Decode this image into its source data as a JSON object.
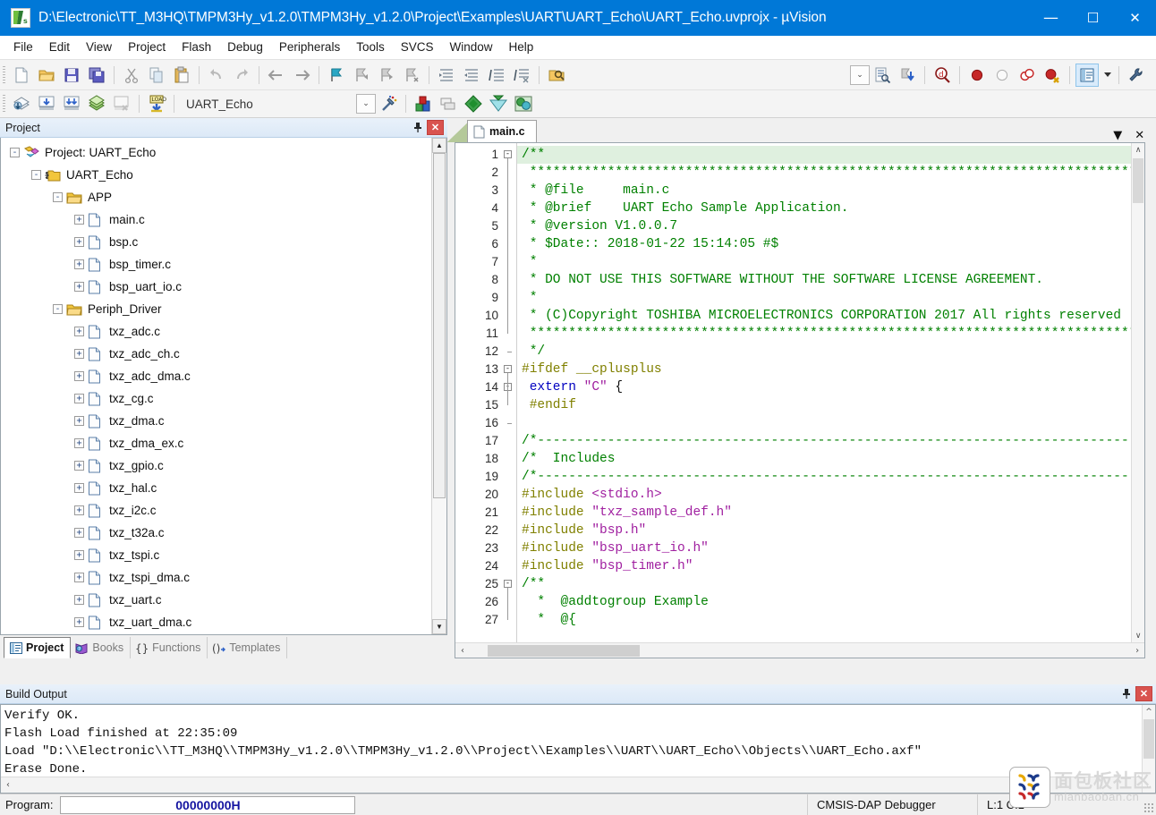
{
  "window": {
    "title": "D:\\Electronic\\TT_M3HQ\\TMPM3Hy_v1.2.0\\TMPM3Hy_v1.2.0\\Project\\Examples\\UART\\UART_Echo\\UART_Echo.uvprojx - µVision",
    "app_icon": "uvision-icon",
    "minimize": "—",
    "maximize": "☐",
    "close": "✕",
    "accent": "#0078d7"
  },
  "menu": {
    "items": [
      "File",
      "Edit",
      "View",
      "Project",
      "Flash",
      "Debug",
      "Peripherals",
      "Tools",
      "SVCS",
      "Window",
      "Help"
    ]
  },
  "toolbar_main": {
    "groups": [
      [
        "new-file-icon",
        "open-file-icon",
        "save-icon",
        "save-all-icon"
      ],
      [
        "cut-icon",
        "copy-icon",
        "paste-icon"
      ],
      [
        "undo-icon",
        "redo-icon"
      ],
      [
        "navigate-back-icon",
        "navigate-forward-icon"
      ],
      [
        "bookmark-toggle-icon",
        "bookmark-previous-icon",
        "bookmark-next-icon",
        "bookmark-clear-icon"
      ],
      [
        "indent-increase-icon",
        "indent-decrease-icon",
        "comment-lines-icon",
        "uncomment-lines-icon"
      ],
      [
        "open-in-explorer-icon"
      ]
    ],
    "right_groups": [
      [
        "search-dropdown-combo",
        "find-in-files-icon",
        "insert-bookmark-icon"
      ],
      [
        "find-icon"
      ],
      [
        "breakpoint-insert-icon",
        "breakpoint-disable-icon",
        "breakpoint-kill-all-icon",
        "breakpoint-disable-all-icon"
      ],
      [
        "project-window-icon",
        "project-window-dropdown-icon"
      ],
      [
        "configuration-wizard-icon"
      ]
    ]
  },
  "toolbar_build": {
    "icons": [
      "translate-file-icon",
      "build-target-icon",
      "rebuild-all-icon",
      "batch-build-icon",
      "stop-build-icon",
      "download-icon"
    ],
    "target_label": "UART_Echo",
    "combo_caret": "⌄",
    "right_icons": [
      "start-debug-session-icon",
      "target-options-icon",
      "manage-project-items-icon",
      "pack-installer-icon",
      "manage-runtime-env-icon",
      "select-software-packs-icon"
    ]
  },
  "project_panel": {
    "caption": "Project",
    "pin_icon": "pin-icon",
    "close_icon": "close-icon",
    "scrollbar": {
      "up": "▲",
      "down": "▼"
    },
    "tree": [
      {
        "label": "Project: UART_Echo",
        "depth": 0,
        "expander": "-",
        "icon": "project-icon"
      },
      {
        "label": "UART_Echo",
        "depth": 1,
        "expander": "-",
        "icon": "target-icon"
      },
      {
        "label": "APP",
        "depth": 2,
        "expander": "-",
        "icon": "folder-icon"
      },
      {
        "label": "main.c",
        "depth": 3,
        "expander": "+",
        "icon": "c-file-icon"
      },
      {
        "label": "bsp.c",
        "depth": 3,
        "expander": "+",
        "icon": "c-file-icon"
      },
      {
        "label": "bsp_timer.c",
        "depth": 3,
        "expander": "+",
        "icon": "c-file-icon"
      },
      {
        "label": "bsp_uart_io.c",
        "depth": 3,
        "expander": "+",
        "icon": "c-file-icon"
      },
      {
        "label": "Periph_Driver",
        "depth": 2,
        "expander": "-",
        "icon": "folder-icon"
      },
      {
        "label": "txz_adc.c",
        "depth": 3,
        "expander": "+",
        "icon": "c-file-icon"
      },
      {
        "label": "txz_adc_ch.c",
        "depth": 3,
        "expander": "+",
        "icon": "c-file-icon"
      },
      {
        "label": "txz_adc_dma.c",
        "depth": 3,
        "expander": "+",
        "icon": "c-file-icon"
      },
      {
        "label": "txz_cg.c",
        "depth": 3,
        "expander": "+",
        "icon": "c-file-icon"
      },
      {
        "label": "txz_dma.c",
        "depth": 3,
        "expander": "+",
        "icon": "c-file-icon"
      },
      {
        "label": "txz_dma_ex.c",
        "depth": 3,
        "expander": "+",
        "icon": "c-file-icon"
      },
      {
        "label": "txz_gpio.c",
        "depth": 3,
        "expander": "+",
        "icon": "c-file-icon"
      },
      {
        "label": "txz_hal.c",
        "depth": 3,
        "expander": "+",
        "icon": "c-file-icon"
      },
      {
        "label": "txz_i2c.c",
        "depth": 3,
        "expander": "+",
        "icon": "c-file-icon"
      },
      {
        "label": "txz_t32a.c",
        "depth": 3,
        "expander": "+",
        "icon": "c-file-icon"
      },
      {
        "label": "txz_tspi.c",
        "depth": 3,
        "expander": "+",
        "icon": "c-file-icon"
      },
      {
        "label": "txz_tspi_dma.c",
        "depth": 3,
        "expander": "+",
        "icon": "c-file-icon"
      },
      {
        "label": "txz_uart.c",
        "depth": 3,
        "expander": "+",
        "icon": "c-file-icon"
      },
      {
        "label": "txz_uart_dma.c",
        "depth": 3,
        "expander": "+",
        "icon": "c-file-icon"
      }
    ],
    "tabs": [
      {
        "label": "Project",
        "icon": "project-tab-icon",
        "selected": true
      },
      {
        "label": "Books",
        "icon": "books-tab-icon",
        "selected": false
      },
      {
        "label": "Functions",
        "icon": "functions-tab-icon",
        "selected": false
      },
      {
        "label": "Templates",
        "icon": "templates-tab-icon",
        "selected": false
      }
    ]
  },
  "editor": {
    "tab_label": "main.c",
    "tab_icon": "c-file-icon",
    "tab_list_caret": "▼",
    "tab_close": "✕",
    "scroll_up": "∧",
    "scroll_down": "∨",
    "hscroll_left": "‹",
    "hscroll_right": "›",
    "lines": [
      {
        "n": 1,
        "fold": "-",
        "highlight": true,
        "segments": [
          {
            "t": "/**",
            "c": "cm"
          }
        ]
      },
      {
        "n": 2,
        "fold": "",
        "highlight": false,
        "segments": [
          {
            "t": " *******************************************************************************",
            "c": "cm"
          }
        ]
      },
      {
        "n": 3,
        "fold": "",
        "highlight": false,
        "segments": [
          {
            "t": " * @file     main.c",
            "c": "cm"
          }
        ]
      },
      {
        "n": 4,
        "fold": "",
        "highlight": false,
        "segments": [
          {
            "t": " * @brief    UART Echo Sample Application.",
            "c": "cm"
          }
        ]
      },
      {
        "n": 5,
        "fold": "",
        "highlight": false,
        "segments": [
          {
            "t": " * @version V1.0.0.7",
            "c": "cm"
          }
        ]
      },
      {
        "n": 6,
        "fold": "",
        "highlight": false,
        "segments": [
          {
            "t": " * $Date:: 2018-01-22 15:14:05 #$",
            "c": "cm"
          }
        ]
      },
      {
        "n": 7,
        "fold": "",
        "highlight": false,
        "segments": [
          {
            "t": " *",
            "c": "cm"
          }
        ]
      },
      {
        "n": 8,
        "fold": "",
        "highlight": false,
        "segments": [
          {
            "t": " * DO NOT USE THIS SOFTWARE WITHOUT THE SOFTWARE LICENSE AGREEMENT.",
            "c": "cm"
          }
        ]
      },
      {
        "n": 9,
        "fold": "",
        "highlight": false,
        "segments": [
          {
            "t": " *",
            "c": "cm"
          }
        ]
      },
      {
        "n": 10,
        "fold": "",
        "highlight": false,
        "segments": [
          {
            "t": " * (C)Copyright TOSHIBA MICROELECTRONICS CORPORATION 2017 All rights reserved",
            "c": "cm"
          }
        ]
      },
      {
        "n": 11,
        "fold": "",
        "highlight": false,
        "segments": [
          {
            "t": " *******************************************************************************",
            "c": "cm"
          }
        ]
      },
      {
        "n": 12,
        "fold": "L",
        "highlight": false,
        "segments": [
          {
            "t": " */",
            "c": "cm"
          }
        ]
      },
      {
        "n": 13,
        "fold": "-",
        "highlight": false,
        "segments": [
          {
            "t": "#ifdef __cplusplus",
            "c": "pp"
          }
        ]
      },
      {
        "n": 14,
        "fold": "-",
        "highlight": false,
        "segments": [
          {
            "t": " ",
            "c": "pl"
          },
          {
            "t": "extern",
            "c": "kw"
          },
          {
            "t": " ",
            "c": "pl"
          },
          {
            "t": "\"C\"",
            "c": "str"
          },
          {
            "t": " {",
            "c": "pl"
          }
        ]
      },
      {
        "n": 15,
        "fold": "",
        "highlight": false,
        "segments": [
          {
            "t": " ",
            "c": "pl"
          },
          {
            "t": "#endif",
            "c": "pp"
          }
        ]
      },
      {
        "n": 16,
        "fold": "T",
        "highlight": false,
        "segments": [
          {
            "t": "",
            "c": "pl"
          }
        ]
      },
      {
        "n": 17,
        "fold": "",
        "highlight": false,
        "segments": [
          {
            "t": "/*-----------------------------------------------------------------------------",
            "c": "cm"
          }
        ]
      },
      {
        "n": 18,
        "fold": "",
        "highlight": false,
        "segments": [
          {
            "t": "/*  Includes",
            "c": "cm"
          }
        ]
      },
      {
        "n": 19,
        "fold": "",
        "highlight": false,
        "segments": [
          {
            "t": "/*-----------------------------------------------------------------------------",
            "c": "cm"
          }
        ]
      },
      {
        "n": 20,
        "fold": "",
        "highlight": false,
        "segments": [
          {
            "t": "#include ",
            "c": "pp"
          },
          {
            "t": "<stdio.h>",
            "c": "str"
          }
        ]
      },
      {
        "n": 21,
        "fold": "",
        "highlight": false,
        "segments": [
          {
            "t": "#include ",
            "c": "pp"
          },
          {
            "t": "\"txz_sample_def.h\"",
            "c": "str"
          }
        ]
      },
      {
        "n": 22,
        "fold": "",
        "highlight": false,
        "segments": [
          {
            "t": "#include ",
            "c": "pp"
          },
          {
            "t": "\"bsp.h\"",
            "c": "str"
          }
        ]
      },
      {
        "n": 23,
        "fold": "",
        "highlight": false,
        "segments": [
          {
            "t": "#include ",
            "c": "pp"
          },
          {
            "t": "\"bsp_uart_io.h\"",
            "c": "str"
          }
        ]
      },
      {
        "n": 24,
        "fold": "",
        "highlight": false,
        "segments": [
          {
            "t": "#include ",
            "c": "pp"
          },
          {
            "t": "\"bsp_timer.h\"",
            "c": "str"
          }
        ]
      },
      {
        "n": 25,
        "fold": "-",
        "highlight": false,
        "segments": [
          {
            "t": "/**",
            "c": "cm"
          }
        ]
      },
      {
        "n": 26,
        "fold": "",
        "highlight": false,
        "segments": [
          {
            "t": "  *  @addtogroup Example",
            "c": "cm"
          }
        ]
      },
      {
        "n": 27,
        "fold": "",
        "highlight": false,
        "segments": [
          {
            "t": "  *  @{",
            "c": "cm"
          }
        ]
      }
    ]
  },
  "build_output": {
    "caption": "Build Output",
    "pin_icon": "pin-icon",
    "close_icon": "close-icon",
    "lines": [
      "Verify OK.",
      "Flash Load finished at 22:35:09",
      "Load \"D:\\\\Electronic\\\\TT_M3HQ\\\\TMPM3Hy_v1.2.0\\\\TMPM3Hy_v1.2.0\\\\Project\\\\Examples\\\\UART\\\\UART_Echo\\\\Objects\\\\UART_Echo.axf\"",
      "Erase Done."
    ],
    "hscroll_left": "‹"
  },
  "statusbar": {
    "program_label": "Program:",
    "program_value": "00000000H",
    "debugger": "CMSIS-DAP Debugger",
    "cursor_position": "L:1 C:1"
  },
  "watermark": {
    "cn": "面包板社区",
    "en": "mianbaoban.cn",
    "logo": "mianbaoban-logo"
  }
}
